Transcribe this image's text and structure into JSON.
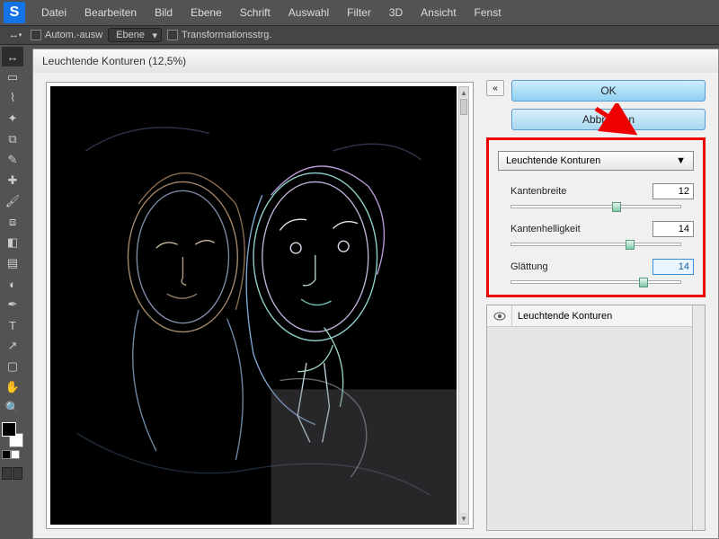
{
  "menubar": {
    "items": [
      "Datei",
      "Bearbeiten",
      "Bild",
      "Ebene",
      "Schrift",
      "Auswahl",
      "Filter",
      "3D",
      "Ansicht",
      "Fenst"
    ]
  },
  "optbar": {
    "tool_hint": "↕₊",
    "autoselect": "Autom.-ausw",
    "dropdown": "Ebene",
    "transform": "Transformationsstrg."
  },
  "dialog": {
    "title": "Leuchtende Konturen (12,5%)"
  },
  "buttons": {
    "ok": "OK",
    "cancel": "Abbrechen"
  },
  "filter": {
    "name": "Leuchtende Konturen",
    "params": [
      {
        "label": "Kantenbreite",
        "value": "12",
        "pos": 62
      },
      {
        "label": "Kantenhelligkeit",
        "value": "14",
        "pos": 70
      },
      {
        "label": "Glättung",
        "value": "14",
        "pos": 78
      }
    ]
  },
  "layers": {
    "item": "Leuchtende Konturen"
  },
  "chart_data": null
}
